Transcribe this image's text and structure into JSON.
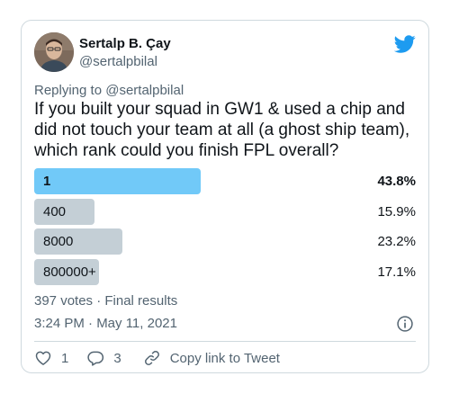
{
  "author": {
    "display_name": "Sertalp B. Çay",
    "handle": "@sertalpbilal"
  },
  "icons": {
    "brand": "twitter-bird-icon",
    "info": "info-icon",
    "like": "heart-icon",
    "reply": "reply-bubble-icon",
    "copy": "link-icon"
  },
  "colors": {
    "twitter_blue": "#1d9bf0",
    "winner_bar": "#71c9f8",
    "other_bar": "#c4cfd6",
    "secondary_text": "#536471"
  },
  "reply": {
    "prefix": "Replying to",
    "mention": "@sertalpbilal"
  },
  "tweet": {
    "text": "If you built your squad in GW1 & used a chip and did not touch your team at all (a ghost ship team), which rank could you finish FPL overall?"
  },
  "poll": {
    "options": [
      {
        "label": "1",
        "percent_text": "43.8%",
        "percent": 43.8,
        "winner": true
      },
      {
        "label": "400",
        "percent_text": "15.9%",
        "percent": 15.9,
        "winner": false
      },
      {
        "label": "8000",
        "percent_text": "23.2%",
        "percent": 23.2,
        "winner": false
      },
      {
        "label": "800000+",
        "percent_text": "17.1%",
        "percent": 17.1,
        "winner": false
      }
    ],
    "meta": "397 votes · Final results"
  },
  "timestamp": "3:24 PM · May 11, 2021",
  "actions": {
    "likes": "1",
    "replies": "3",
    "copy_label": "Copy link to Tweet"
  }
}
